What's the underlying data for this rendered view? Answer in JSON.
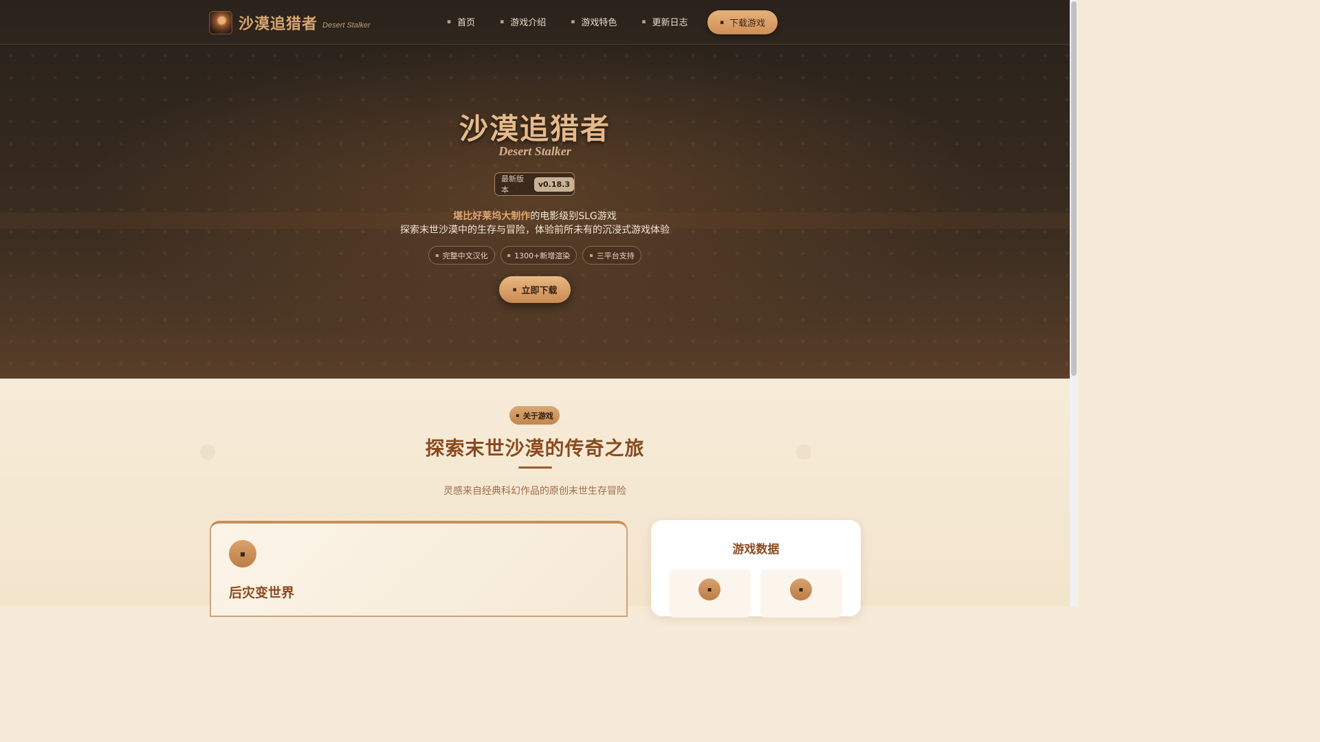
{
  "nav": {
    "brand_title": "沙漠追猎者",
    "brand_sub": "Desert Stalker",
    "links": [
      {
        "label": "首页",
        "icon": "home-icon"
      },
      {
        "label": "游戏介绍",
        "icon": "info-icon"
      },
      {
        "label": "游戏特色",
        "icon": "star-icon"
      },
      {
        "label": "更新日志",
        "icon": "log-icon"
      }
    ],
    "download_label": "下载游戏",
    "glyph": "▪"
  },
  "hero": {
    "title": "沙漠追猎者",
    "subtitle": "Desert Stalker",
    "version_label": "最新版本",
    "version_value": "v0.18.3",
    "line1_highlight": "堪比好莱坞大制作",
    "line1_rest": "的电影级别SLG游戏",
    "line2": "探索末世沙漠中的生存与冒险，体验前所未有的沉浸式游戏体验",
    "tags": [
      "完整中文汉化",
      "1300+新增渲染",
      "三平台支持"
    ],
    "cta_label": "立即下载"
  },
  "about": {
    "badge": "关于游戏",
    "title": "探索末世沙漠的传奇之旅",
    "desc": "灵感来自经典科幻作品的原创末世生存冒险",
    "card_title": "后灾变世界",
    "stats_title": "游戏数据"
  },
  "colors": {
    "accent": "#c98e58",
    "title_brown": "#8a4a1f",
    "nav_bg": "#2a221b"
  }
}
